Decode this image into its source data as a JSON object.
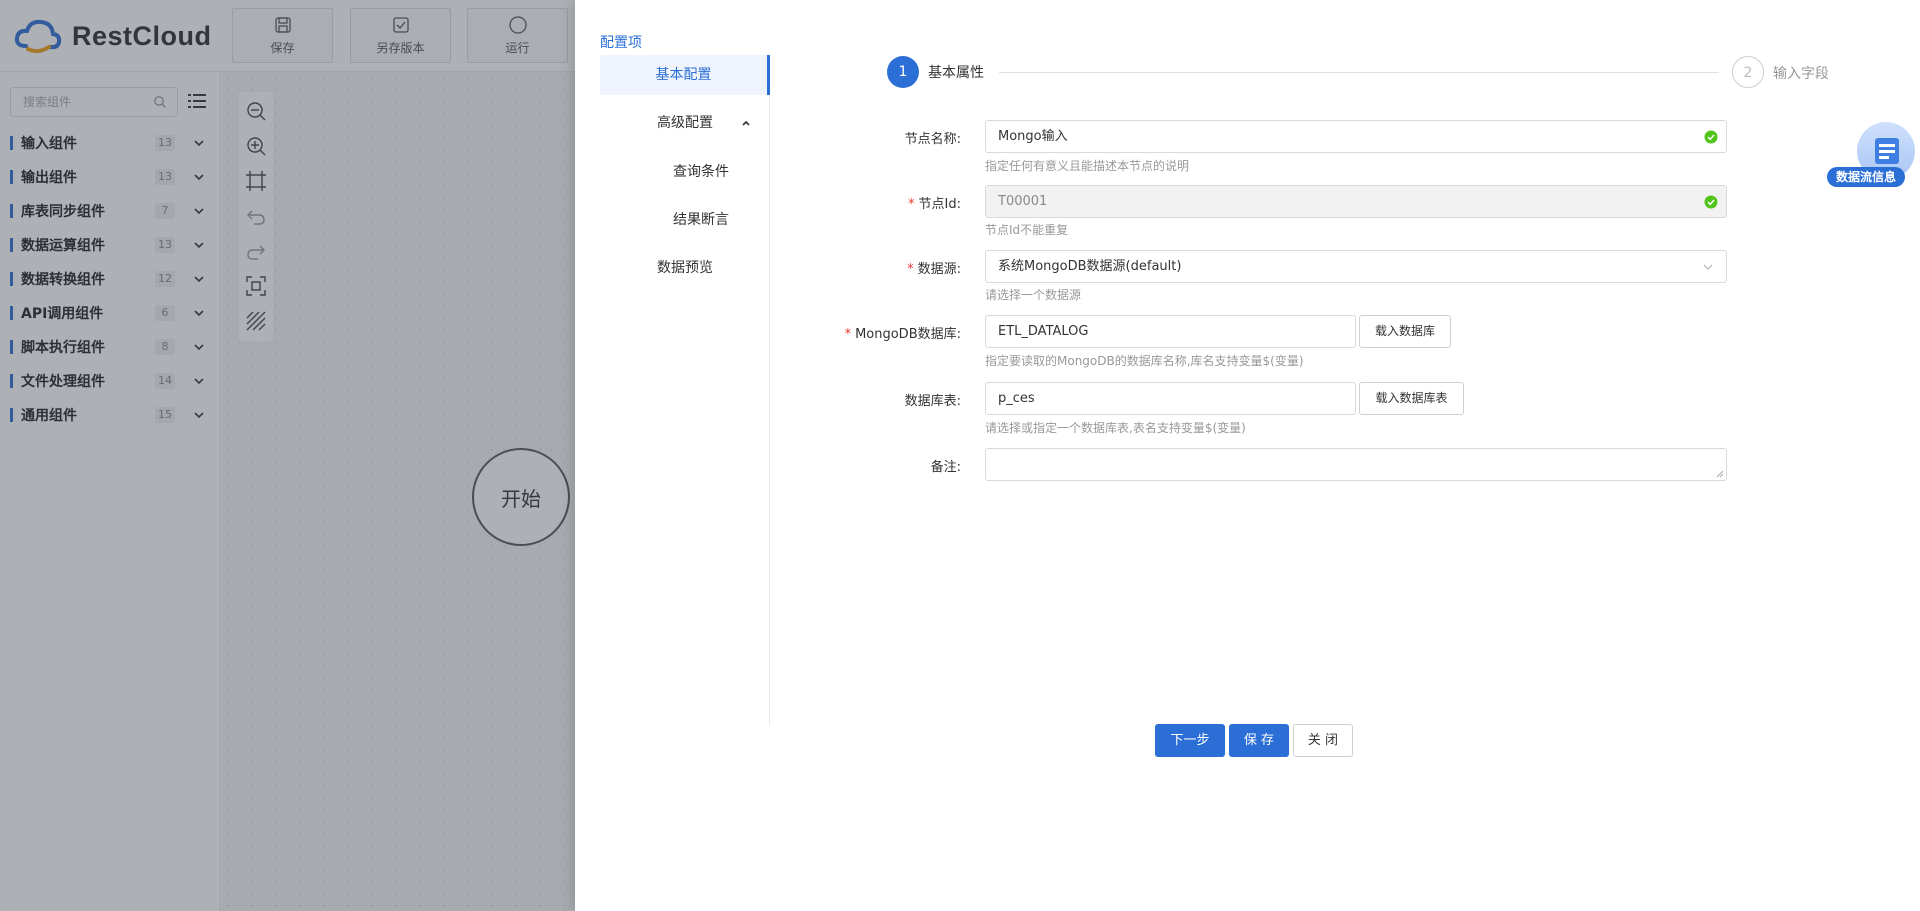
{
  "app": {
    "logo_text": "RestCloud",
    "toolbar": [
      {
        "label": "保存",
        "icon": "save-icon"
      },
      {
        "label": "另存版本",
        "icon": "save-version-icon"
      },
      {
        "label": "运行",
        "icon": "run-icon"
      }
    ]
  },
  "sidebar": {
    "search_placeholder": "搜索组件",
    "categories": [
      {
        "label": "输入组件",
        "count": "13"
      },
      {
        "label": "输出组件",
        "count": "13"
      },
      {
        "label": "库表同步组件",
        "count": "7"
      },
      {
        "label": "数据运算组件",
        "count": "13"
      },
      {
        "label": "数据转换组件",
        "count": "12"
      },
      {
        "label": "API调用组件",
        "count": "6"
      },
      {
        "label": "脚本执行组件",
        "count": "8"
      },
      {
        "label": "文件处理组件",
        "count": "14"
      },
      {
        "label": "通用组件",
        "count": "15"
      }
    ]
  },
  "canvas": {
    "start_node_label": "开始",
    "tools": [
      "zoom-out-icon",
      "zoom-in-icon",
      "fit-view-icon",
      "undo-icon",
      "redo-icon",
      "fullscreen-icon",
      "grid-toggle-icon"
    ]
  },
  "drawer": {
    "title": "配置项",
    "nav": {
      "basic": "基本配置",
      "advanced": "高级配置",
      "query": "查询条件",
      "assert": "结果断言",
      "preview": "数据预览"
    },
    "steps": {
      "step1_num": "1",
      "step1_label": "基本属性",
      "step2_num": "2",
      "step2_label": "输入字段"
    },
    "form": {
      "node_name_label": "节点名称:",
      "node_name_value": "Mongo输入",
      "node_name_hint": "指定任何有意义且能描述本节点的说明",
      "node_id_label": "节点Id:",
      "node_id_value": "T00001",
      "node_id_hint": "节点Id不能重复",
      "datasource_label": "数据源:",
      "datasource_value": "系统MongoDB数据源(default)",
      "datasource_hint": "请选择一个数据源",
      "mongodb_label": "MongoDB数据库:",
      "mongodb_value": "ETL_DATALOG",
      "mongodb_btn": "载入数据库",
      "mongodb_hint": "指定要读取的MongoDB的数据库名称,库名支持变量$(变量)",
      "table_label": "数据库表:",
      "table_value": "p_ces",
      "table_btn": "载入数据库表",
      "table_hint": "请选择或指定一个数据库表,表名支持变量$(变量)",
      "remark_label": "备注:",
      "remark_value": ""
    },
    "buttons": {
      "next": "下一步",
      "save": "保 存",
      "close": "关 闭"
    },
    "flow_info_label": "数据流信息"
  },
  "colors": {
    "primary": "#2b6fd6",
    "required": "#e53935",
    "success": "#52c41a"
  }
}
